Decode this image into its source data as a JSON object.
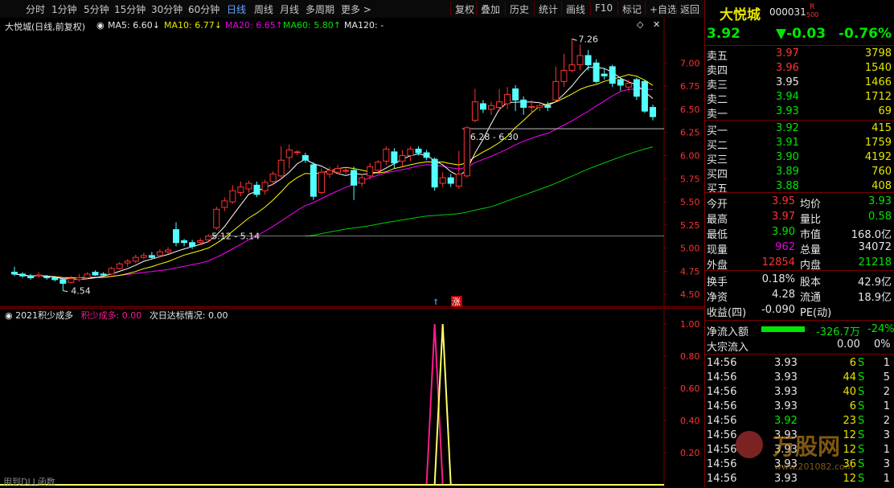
{
  "toolbar": {
    "periods": [
      "分时",
      "1分钟",
      "5分钟",
      "15分钟",
      "30分钟",
      "60分钟",
      "日线",
      "周线",
      "月线",
      "多周期",
      "更多 >"
    ],
    "active_period": "日线",
    "tools": [
      "复权",
      "叠加",
      "历史",
      "统计",
      "画线",
      "F10",
      "标记",
      "+自选",
      "返回"
    ]
  },
  "chart_title": "大悦城(日线,前复权)",
  "ma_labels": {
    "ma5": "MA5: 6.60↓",
    "ma10": "MA10: 6.77↓",
    "ma20": "MA20: 6.65↑",
    "ma60": "MA60: 5.80↑",
    "ma120": "MA120: -"
  },
  "price_axis": [
    "7.00",
    "6.75",
    "6.50",
    "6.25",
    "6.00",
    "5.75",
    "5.50",
    "5.25",
    "5.00",
    "4.75",
    "4.50"
  ],
  "annotations": {
    "high": "7.26",
    "low": "4.54",
    "range1": "6.28 - 6.30",
    "range2": "5.12 - 5.14",
    "zhang": "涨"
  },
  "indicator": {
    "title": "2021积少成多",
    "label1": "积少成多: 0.00",
    "label2": "次日达标情况: 0.00",
    "axis": [
      "1.00",
      "0.80",
      "0.60",
      "0.40",
      "0.20"
    ],
    "footer": "用到DLL函数"
  },
  "stock": {
    "name": "大悦城",
    "code": "000031",
    "flag_r": "R",
    "flag_500": "500",
    "price": "3.92",
    "change": "▼-0.03",
    "pct": "-0.76%"
  },
  "sell": [
    {
      "label": "卖五",
      "price": "3.97",
      "vol": "3798"
    },
    {
      "label": "卖四",
      "price": "3.96",
      "vol": "1540"
    },
    {
      "label": "卖三",
      "price": "3.95",
      "vol": "1466"
    },
    {
      "label": "卖二",
      "price": "3.94",
      "vol": "1712"
    },
    {
      "label": "卖一",
      "price": "3.93",
      "vol": "69"
    }
  ],
  "buy": [
    {
      "label": "买一",
      "price": "3.92",
      "vol": "415"
    },
    {
      "label": "买二",
      "price": "3.91",
      "vol": "1759"
    },
    {
      "label": "买三",
      "price": "3.90",
      "vol": "4192"
    },
    {
      "label": "买四",
      "price": "3.89",
      "vol": "760"
    },
    {
      "label": "买五",
      "price": "3.88",
      "vol": "408"
    }
  ],
  "stats": [
    {
      "l1": "今开",
      "v1": "3.95",
      "l2": "均价",
      "v2": "3.93"
    },
    {
      "l1": "最高",
      "v1": "3.97",
      "l2": "量比",
      "v2": "0.58"
    },
    {
      "l1": "最低",
      "v1": "3.90",
      "l2": "市值",
      "v2": "168.0亿"
    },
    {
      "l1": "现量",
      "v1": "962",
      "l2": "总量",
      "v2": "34072"
    },
    {
      "l1": "外盘",
      "v1": "12854",
      "l2": "内盘",
      "v2": "21218"
    }
  ],
  "stats2": [
    {
      "l1": "换手",
      "v1": "0.18%",
      "l2": "股本",
      "v2": "42.9亿"
    },
    {
      "l1": "净资",
      "v1": "4.28",
      "l2": "流通",
      "v2": "18.9亿"
    },
    {
      "l1": "收益(四)",
      "v1": "-0.090",
      "l2": "PE(动)",
      "v2": ""
    }
  ],
  "flow": {
    "label": "净流入额",
    "value": "-326.7万",
    "pct": "-24%",
    "label2": "大宗流入",
    "value2": "0.00",
    "pct2": "0%"
  },
  "ticks": [
    {
      "time": "14:56",
      "price": "3.93",
      "vol": "6",
      "side": "S",
      "n": "1"
    },
    {
      "time": "14:56",
      "price": "3.93",
      "vol": "44",
      "side": "S",
      "n": "5"
    },
    {
      "time": "14:56",
      "price": "3.93",
      "vol": "40",
      "side": "S",
      "n": "2"
    },
    {
      "time": "14:56",
      "price": "3.93",
      "vol": "6",
      "side": "S",
      "n": "1"
    },
    {
      "time": "14:56",
      "price": "3.92",
      "vol": "23",
      "side": "S",
      "n": "2"
    },
    {
      "time": "14:56",
      "price": "3.93",
      "vol": "12",
      "side": "S",
      "n": "3"
    },
    {
      "time": "14:56",
      "price": "3.93",
      "vol": "12",
      "side": "S",
      "n": "1"
    },
    {
      "time": "14:56",
      "price": "3.93",
      "vol": "36",
      "side": "S",
      "n": "3"
    },
    {
      "time": "14:56",
      "price": "3.93",
      "vol": "12",
      "side": "S",
      "n": "1"
    }
  ],
  "watermark": {
    "text": "万股网",
    "url": "www.201082.com"
  },
  "colors": {
    "up": "#ff3232",
    "down": "#54ffff",
    "ma5": "#ffffff",
    "ma10": "#ffff00",
    "ma20": "#ff00ff",
    "ma60": "#00cc00",
    "sig1": "#ff1a8c",
    "sig2": "#ffff66"
  },
  "chart_data": {
    "type": "candlestick",
    "ylim": [
      4.45,
      7.35
    ],
    "candles": [
      [
        4.74,
        4.72,
        4.8,
        4.7
      ],
      [
        4.72,
        4.7,
        4.74,
        4.68
      ],
      [
        4.7,
        4.68,
        4.72,
        4.66
      ],
      [
        4.7,
        4.71,
        4.74,
        4.68
      ],
      [
        4.69,
        4.68,
        4.71,
        4.66
      ],
      [
        4.68,
        4.66,
        4.7,
        4.64
      ],
      [
        4.66,
        4.62,
        4.67,
        4.54
      ],
      [
        4.63,
        4.67,
        4.7,
        4.62
      ],
      [
        4.66,
        4.68,
        4.72,
        4.64
      ],
      [
        4.68,
        4.72,
        4.74,
        4.66
      ],
      [
        4.74,
        4.71,
        4.76,
        4.7
      ],
      [
        4.72,
        4.71,
        4.74,
        4.7
      ],
      [
        4.72,
        4.78,
        4.8,
        4.71
      ],
      [
        4.78,
        4.83,
        4.85,
        4.77
      ],
      [
        4.84,
        4.86,
        4.88,
        4.8
      ],
      [
        4.86,
        4.9,
        4.93,
        4.84
      ],
      [
        4.9,
        4.92,
        4.95,
        4.88
      ],
      [
        4.92,
        4.9,
        4.96,
        4.88
      ],
      [
        4.92,
        4.96,
        4.99,
        4.9
      ],
      [
        4.96,
        4.98,
        5.01,
        4.94
      ],
      [
        5.2,
        5.06,
        5.28,
        5.02
      ],
      [
        5.08,
        5.06,
        5.1,
        5.02
      ],
      [
        5.06,
        5.02,
        5.09,
        4.99
      ],
      [
        5.06,
        5.08,
        5.11,
        5.03
      ],
      [
        5.09,
        5.13,
        5.15,
        5.06
      ],
      [
        5.22,
        5.42,
        5.45,
        5.2
      ],
      [
        5.44,
        5.51,
        5.55,
        5.4
      ],
      [
        5.5,
        5.62,
        5.68,
        5.48
      ],
      [
        5.6,
        5.66,
        5.72,
        5.56
      ],
      [
        5.64,
        5.7,
        5.73,
        5.6
      ],
      [
        5.68,
        5.58,
        5.72,
        5.55
      ],
      [
        5.62,
        5.71,
        5.74,
        5.58
      ],
      [
        5.72,
        5.8,
        5.83,
        5.68
      ],
      [
        5.78,
        5.95,
        6.1,
        5.76
      ],
      [
        5.98,
        6.06,
        6.12,
        5.86
      ],
      [
        6.04,
        6.04,
        6.06,
        6.0
      ],
      [
        6.0,
        5.95,
        6.03,
        5.92
      ],
      [
        5.9,
        5.56,
        5.93,
        5.52
      ],
      [
        5.6,
        5.82,
        5.86,
        5.58
      ],
      [
        5.8,
        5.84,
        5.88,
        5.76
      ],
      [
        5.82,
        5.86,
        5.9,
        5.8
      ],
      [
        5.84,
        5.84,
        5.88,
        5.8
      ],
      [
        5.84,
        5.68,
        5.88,
        5.52
      ],
      [
        5.7,
        5.76,
        5.8,
        5.66
      ],
      [
        5.78,
        5.88,
        5.92,
        5.74
      ],
      [
        5.84,
        5.93,
        5.95,
        5.8
      ],
      [
        5.94,
        6.07,
        6.1,
        5.9
      ],
      [
        6.04,
        5.92,
        6.08,
        5.86
      ],
      [
        5.94,
        6.0,
        6.06,
        5.88
      ],
      [
        6.0,
        6.07,
        6.1,
        5.94
      ],
      [
        6.07,
        6.03,
        6.1,
        6.0
      ],
      [
        6.03,
        5.98,
        6.06,
        5.95
      ],
      [
        5.96,
        5.66,
        5.98,
        5.62
      ],
      [
        5.7,
        5.76,
        5.82,
        5.66
      ],
      [
        5.76,
        5.7,
        5.8,
        5.66
      ],
      [
        5.67,
        5.8,
        6.05,
        5.64
      ],
      [
        5.78,
        6.3,
        6.32,
        5.76
      ],
      [
        6.38,
        6.58,
        6.72,
        6.36
      ],
      [
        6.56,
        6.5,
        6.6,
        6.46
      ],
      [
        6.5,
        6.54,
        6.58,
        6.44
      ],
      [
        6.52,
        6.58,
        6.72,
        6.48
      ],
      [
        6.56,
        6.66,
        6.74,
        6.5
      ],
      [
        6.72,
        6.6,
        6.76,
        6.48
      ],
      [
        6.6,
        6.52,
        6.64,
        6.44
      ],
      [
        6.52,
        6.53,
        6.6,
        6.45
      ],
      [
        6.52,
        6.54,
        6.58,
        6.48
      ],
      [
        6.54,
        6.52,
        6.58,
        6.48
      ],
      [
        6.6,
        6.8,
        6.96,
        6.58
      ],
      [
        6.8,
        6.92,
        7.1,
        6.74
      ],
      [
        6.92,
        6.98,
        7.26,
        6.9
      ],
      [
        6.98,
        7.08,
        7.2,
        6.92
      ],
      [
        7.08,
        6.98,
        7.14,
        6.92
      ],
      [
        7.0,
        6.8,
        7.04,
        6.78
      ],
      [
        6.88,
        6.86,
        6.94,
        6.82
      ],
      [
        6.96,
        6.78,
        6.98,
        6.74
      ],
      [
        6.82,
        6.76,
        6.84,
        6.7
      ],
      [
        6.74,
        6.78,
        6.82,
        6.7
      ],
      [
        6.82,
        6.64,
        6.84,
        6.6
      ],
      [
        6.8,
        6.48,
        6.82,
        6.46
      ],
      [
        6.52,
        6.42,
        6.55,
        6.38
      ]
    ],
    "indicator_series": [
      {
        "name": "积少成多",
        "spike_at": 52,
        "value": 1.0
      },
      {
        "name": "次日达标情况",
        "spike_at": 53,
        "value": 1.0
      }
    ]
  }
}
